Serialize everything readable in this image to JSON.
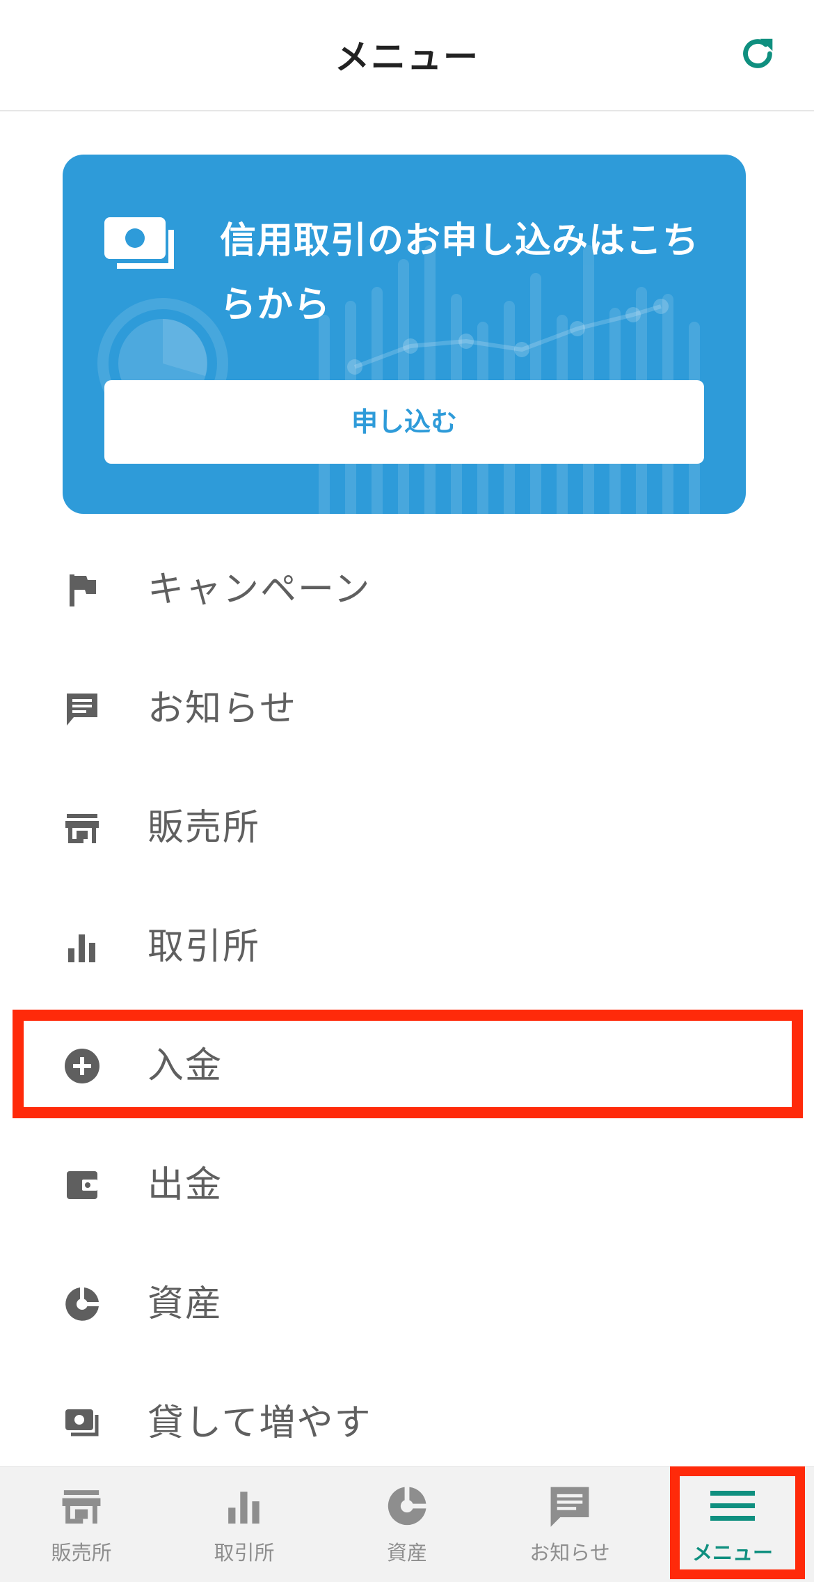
{
  "header": {
    "title": "メニュー"
  },
  "banner": {
    "text": "信用取引のお申し込みはこちらから",
    "button_label": "申し込む"
  },
  "menu": {
    "items": [
      {
        "label": "キャンペーン",
        "icon": "flag-icon"
      },
      {
        "label": "お知らせ",
        "icon": "message-icon"
      },
      {
        "label": "販売所",
        "icon": "store-icon"
      },
      {
        "label": "取引所",
        "icon": "bar-chart-icon"
      },
      {
        "label": "入金",
        "icon": "plus-circle-icon"
      },
      {
        "label": "出金",
        "icon": "wallet-icon"
      },
      {
        "label": "資産",
        "icon": "pie-chart-icon"
      },
      {
        "label": "貸して増やす",
        "icon": "cash-icon"
      }
    ]
  },
  "tabbar": {
    "tabs": [
      {
        "label": "販売所",
        "icon": "store-icon"
      },
      {
        "label": "取引所",
        "icon": "bar-chart-icon"
      },
      {
        "label": "資産",
        "icon": "pie-chart-icon"
      },
      {
        "label": "お知らせ",
        "icon": "message-icon"
      },
      {
        "label": "メニュー",
        "icon": "hamburger-icon"
      }
    ],
    "active": "メニュー"
  },
  "colors": {
    "accent_teal": "#0f8f7f",
    "banner_blue": "#2e9bd9",
    "highlight_red": "#ff2a0a",
    "icon_gray": "#5f5f5f"
  }
}
